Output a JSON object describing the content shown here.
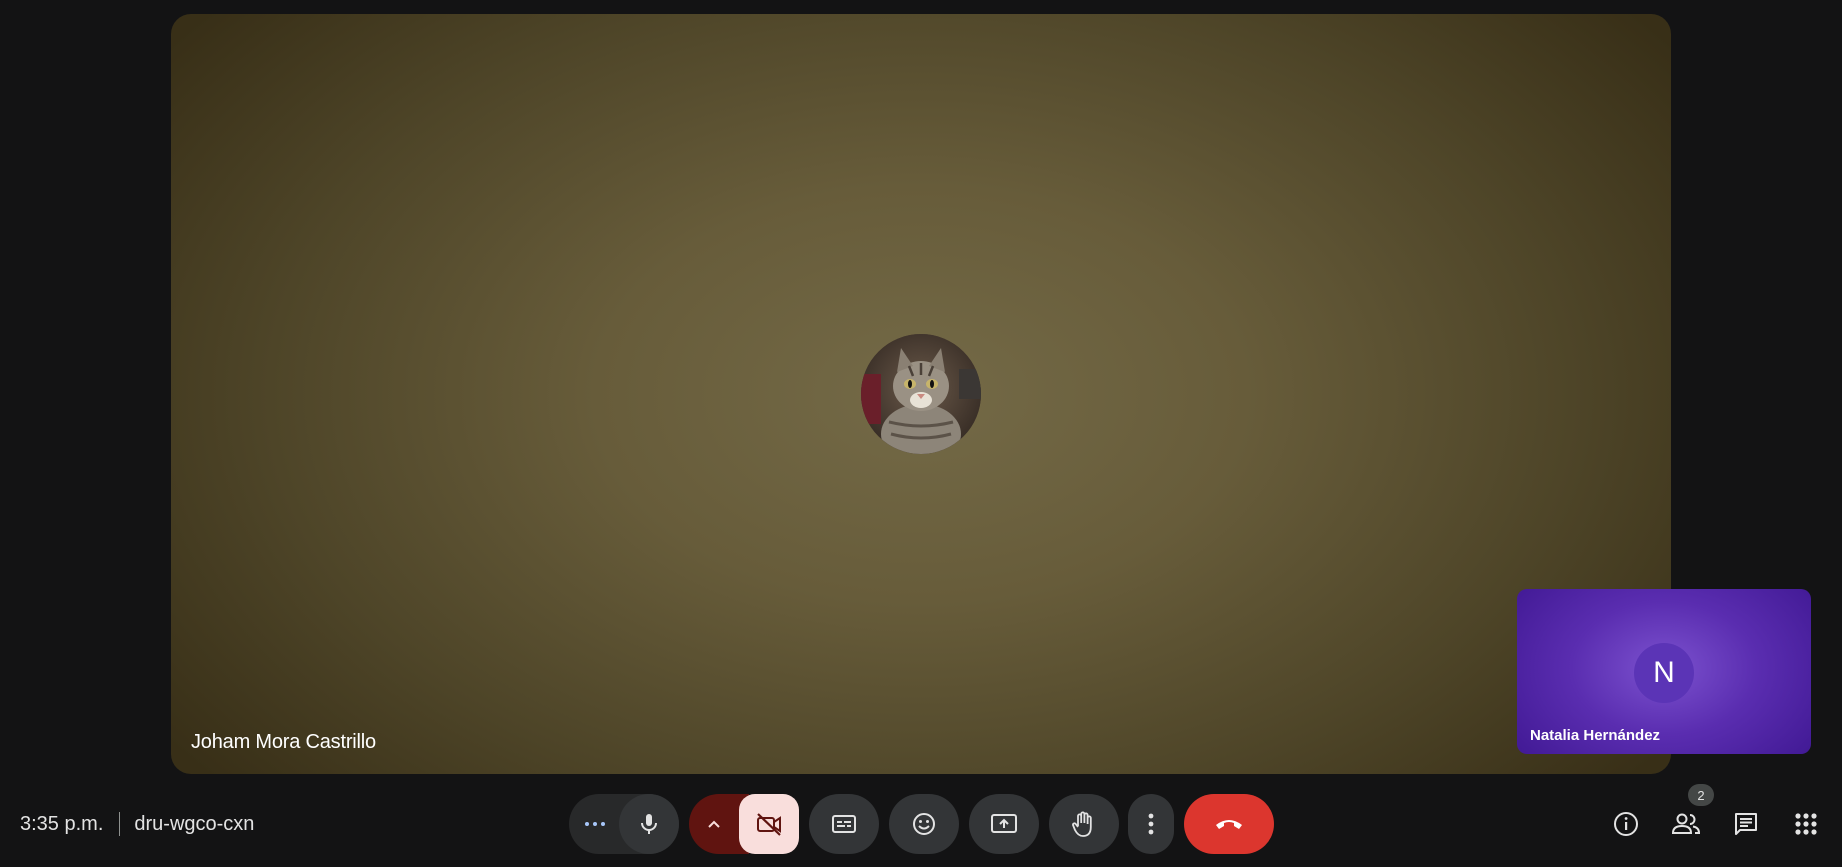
{
  "main_participant": {
    "name": "Joham Mora Castrillo",
    "avatar_icon": "cat-photo-avatar"
  },
  "self_view": {
    "name": "Natalia Hernández",
    "initial": "N",
    "color": "#5b34b6"
  },
  "meeting": {
    "time": "3:35 p.m.",
    "code": "dru-wgco-cxn"
  },
  "controls": {
    "more_audio_icon": "more-horizontal-icon",
    "mic_icon": "mic-icon",
    "camera_options_icon": "chevron-up-icon",
    "camera_icon": "camera-off-icon",
    "captions_icon": "closed-captions-icon",
    "reactions_icon": "emoji-icon",
    "present_icon": "present-screen-icon",
    "raise_hand_icon": "raise-hand-icon",
    "more_options_icon": "more-vertical-icon",
    "end_call_icon": "end-call-icon",
    "end_call_color": "#dc362e"
  },
  "right_panel": {
    "info_icon": "info-icon",
    "people_icon": "people-icon",
    "people_count": "2",
    "chat_icon": "chat-icon",
    "activities_icon": "apps-grid-icon"
  }
}
